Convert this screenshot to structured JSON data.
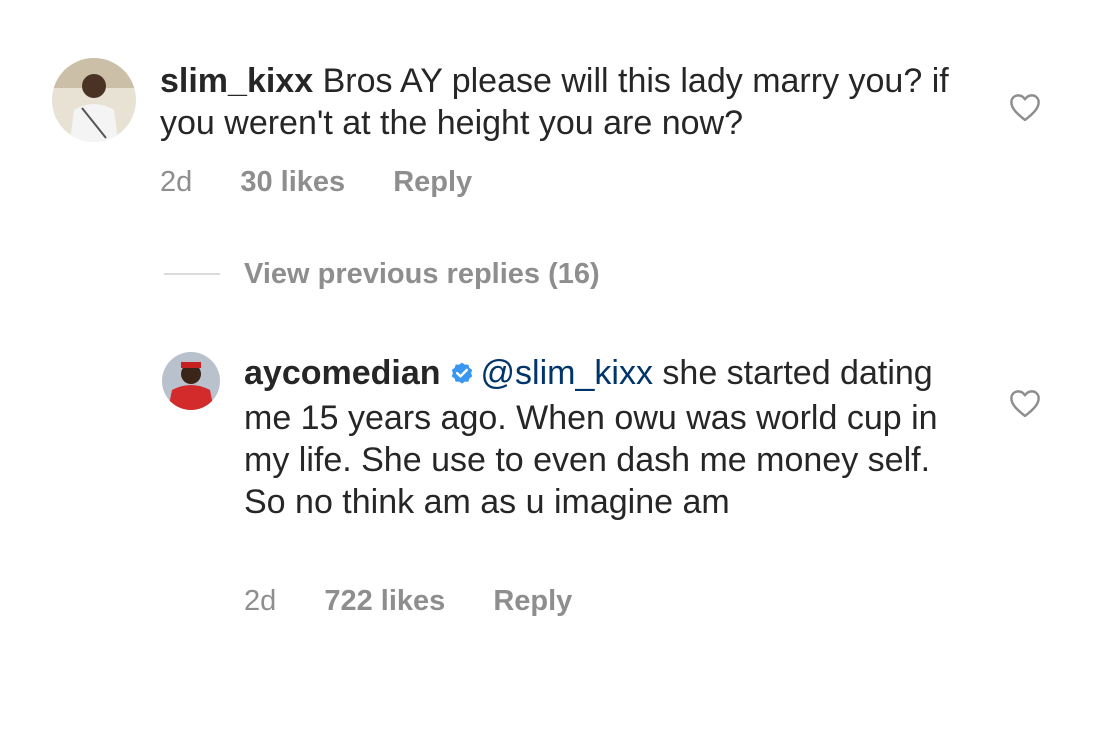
{
  "comment": {
    "username": "slim_kixx",
    "text": "Bros AY please will this lady marry you? if you weren't at the height you are now?",
    "time": "2d",
    "likes": "30 likes",
    "reply_label": "Reply"
  },
  "view_previous": "View previous replies (16)",
  "reply": {
    "username": "aycomedian",
    "mention": "@slim_kixx",
    "text": "she started dating me 15 years ago. When owu was world cup in my life. She use to even dash me money self. So no think am as u imagine am",
    "time": "2d",
    "likes": "722 likes",
    "reply_label": "Reply"
  },
  "colors": {
    "verified": "#3897f0",
    "mention": "#003569",
    "muted": "#8e8e8e"
  },
  "icons": {
    "like": "heart-outline-icon",
    "verified": "verified-badge-icon"
  }
}
